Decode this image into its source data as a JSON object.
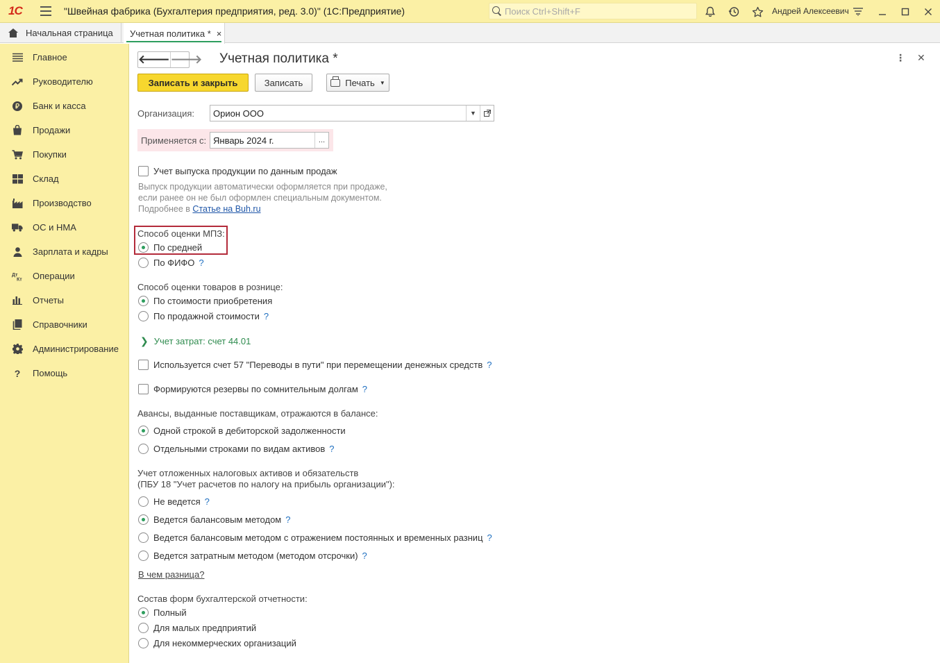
{
  "titlebar": {
    "logo": "1С",
    "title": "\"Швейная фабрика (Бухгалтерия предприятия, ред. 3.0)\"  (1С:Предприятие)",
    "search_placeholder": "Поиск Ctrl+Shift+F",
    "user": "Андрей Алексеевич"
  },
  "tabs": {
    "home": "Начальная страница",
    "policy": "Учетная политика *",
    "close": "×"
  },
  "sidebar": {
    "items": [
      {
        "label": "Главное"
      },
      {
        "label": "Руководителю"
      },
      {
        "label": "Банк и касса"
      },
      {
        "label": "Продажи"
      },
      {
        "label": "Покупки"
      },
      {
        "label": "Склад"
      },
      {
        "label": "Производство"
      },
      {
        "label": "ОС и НМА"
      },
      {
        "label": "Зарплата и кадры"
      },
      {
        "label": "Операции"
      },
      {
        "label": "Отчеты"
      },
      {
        "label": "Справочники"
      },
      {
        "label": "Администрирование"
      },
      {
        "label": "Помощь"
      }
    ]
  },
  "form": {
    "title": "Учетная политика *",
    "btn_save_close": "Записать и закрыть",
    "btn_save": "Записать",
    "btn_print": "Печать",
    "org_label": "Организация:",
    "org_value": "Орион ООО",
    "applies_label": "Применяется с:",
    "applies_value": "Январь 2024 г.",
    "applies_btn": "...",
    "sales_output_label": "Учет выпуска продукции по данным продаж",
    "hint_line1": "Выпуск продукции автоматически оформляется при продаже,",
    "hint_line2": "если ранее он не был оформлен специальным документом.",
    "hint_line3_prefix": "Подробнее в ",
    "hint_link": "Статье на Buh.ru",
    "mpz_label": "Способ оценки МПЗ:",
    "mpz_avg": "По средней",
    "mpz_fifo": "По ФИФО",
    "retail_label": "Способ оценки товаров в рознице:",
    "retail_cost": "По стоимости приобретения",
    "retail_sale": "По продажной стоимости",
    "expense_group": "Учет затрат: счет 44.01",
    "acc57_label": "Используется счет 57 \"Переводы в пути\" при перемещении денежных средств",
    "reserves_label": "Формируются резервы по сомнительным долгам",
    "advances_label": "Авансы, выданные поставщикам, отражаются в балансе:",
    "adv_one": "Одной строкой в дебиторской задолженности",
    "adv_sep": "Отдельными строками по видам активов",
    "deferred_line1": "Учет отложенных налоговых активов и обязательств",
    "deferred_line2": "(ПБУ 18 \"Учет расчетов по налогу на прибыль организации\"):",
    "def_none": "Не ведется",
    "def_balance": "Ведется балансовым методом",
    "def_balance_diff": "Ведется балансовым методом с отражением постоянных и временных разниц",
    "def_cost": "Ведется затратным методом (методом отсрочки)",
    "diff_link": "В чем разница?",
    "forms_label": "Состав форм бухгалтерской отчетности:",
    "forms_full": "Полный",
    "forms_small": "Для малых предприятий",
    "forms_nonprofit": "Для некоммерческих организаций",
    "help_mark": "?"
  },
  "colors": {
    "accent_yellow": "#fbf0a5",
    "primary_button": "#f7d72e",
    "radio_selected": "#2e9e5e",
    "highlight_border": "#b32a3a",
    "applies_bg": "#fce6e9",
    "link": "#1f56a8"
  },
  "state": {
    "mpz_method": "По средней",
    "retail_method": "По стоимости приобретения",
    "advances": "Одной строкой в дебиторской задолженности",
    "deferred_tax": "Ведется балансовым методом",
    "report_forms": "Полный"
  }
}
